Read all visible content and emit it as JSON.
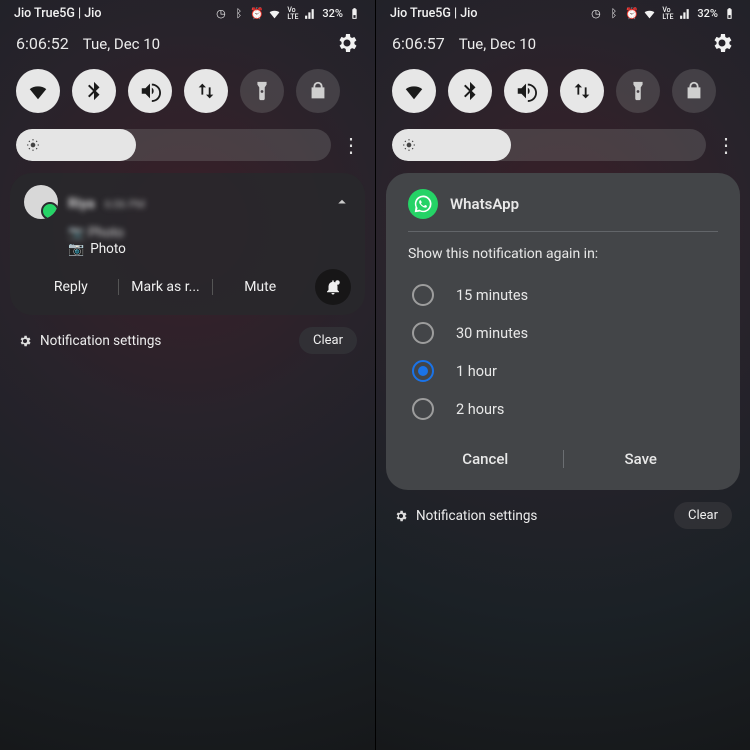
{
  "left": {
    "status": {
      "carrier": "Jio True5G | Jio",
      "battery": "32%"
    },
    "clock": {
      "time": "6:06:52",
      "date": "Tue, Dec 10"
    },
    "notification": {
      "sender": "Riya",
      "time": "6:06 PM",
      "line1": "📷 Photo",
      "line2_icon": "📷",
      "line2_text": "Photo",
      "actions": {
        "reply": "Reply",
        "mark": "Mark as r...",
        "mute": "Mute"
      }
    },
    "footer": {
      "settings": "Notification settings",
      "clear": "Clear"
    }
  },
  "right": {
    "status": {
      "carrier": "Jio True5G | Jio",
      "battery": "32%"
    },
    "clock": {
      "time": "6:06:57",
      "date": "Tue, Dec 10"
    },
    "snooze": {
      "app": "WhatsApp",
      "prompt": "Show this notification again in:",
      "options": [
        "15 minutes",
        "30 minutes",
        "1 hour",
        "2 hours"
      ],
      "selected_index": 2,
      "cancel": "Cancel",
      "save": "Save"
    },
    "footer": {
      "settings": "Notification settings",
      "clear": "Clear"
    }
  }
}
